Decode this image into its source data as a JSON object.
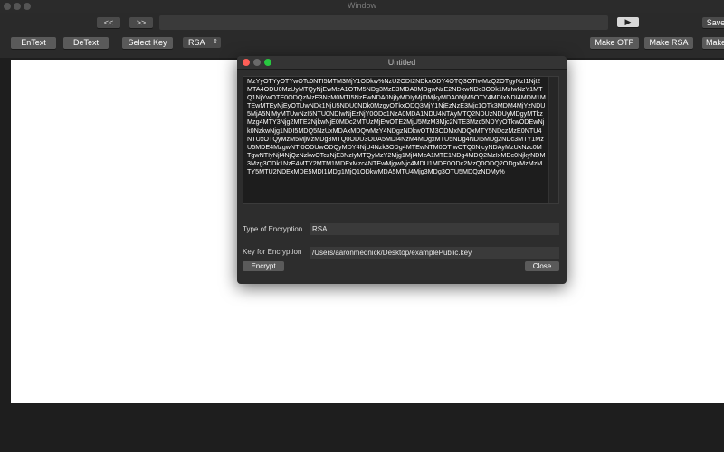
{
  "window": {
    "title": "Window"
  },
  "nav": {
    "back_label": "<<",
    "forward_label": ">>",
    "url_value": "",
    "go_label": "▶"
  },
  "toolbar": {
    "save_label": "Save",
    "entext_label": "EnText",
    "detext_label": "DeText",
    "select_key_label": "Select Key",
    "algorithm_selected": "RSA",
    "make_otp_label": "Make OTP",
    "make_rsa_label": "Make RSA",
    "make_more_label": "Make"
  },
  "dialog": {
    "title": "Untitled",
    "text_body": "MzYyOTYyOTYwOTc0NTI5MTM3MjY1ODkw%NzU2ODI2NDkxODY4OTQ3OTIwMzQ2OTgyNzI1NjI2MTA4ODU0MzUyMTQyNjEwMzA1OTM5NDg3MzE3MDA0MDgwNzE2NDkwNDc3ODk1MzIwNzY1MTQ1NjYwOTE0ODQzMzE3NzM0MTI5NzEwNDA0NjIyMDIyMjI0MjkyMDA0NjM5OTY4MDIxNDI4MDM1MTEwMTEyNjEyOTUwNDk1NjU5NDU0NDk0MzgyOTkxODQ3MjY1NjEzNzE3Mjc1OTk3MDM4MjYzNDU5MjA5NjMyMTUwNzI5NTU0NDIwNjEzNjY0ODc1NzA0MDA1NDU4NTAyMTQ2NDUzNDUyMDgyMTkzMzg4MTY3Njg2MTE2NjkwNjE0MDc2MTUzMjEwOTE2MjU5MzM3Mjc2NTE3Mzc5NDYyOTkwODEwNjk0NzkwNjg1NDI5MDQ5NzUxMDAxMDQwMzY4NDgzNDkwOTM3ODMxNDQxMTY5NDczMzE0NTU4NTUxOTQyMzM5MjMzMDg3MTQ0ODU3ODA5MDI4NzM4MDgxMTU5NDg4NDI5MDg2NDc3MTY1MzU5MDE4MzgwNTI0ODUwODQyMDY4NjU4Nzk3ODg4MTEwNTM0OTIwOTQ0NjcyNDAyMzUxNzc0MTgwNTIyNjI4NjQzNzkwOTczNjE3NzIyMTQyMzY2Mjg1MjI4MzA1MTE1NDg4MDQ2MzIxMDc0NjkyNDM3Mzg3ODk1NzE4MTY2MTM1MDExMzc4NTEwMjgwNjc4MDU1MDE0ODc2MzQ0ODQ2ODgxMzMzMTY5MTU2NDExMDE5MDI1MDg1MjQ1ODkwMDA5MTU4Mjg3MDg3OTU5MDQzNDMy%",
    "encryption_type_label": "Type of Encryption",
    "encryption_type_value": "RSA",
    "key_label": "Key for Encryption",
    "key_value": "/Users/aaronmednick/Desktop/examplePublic.key",
    "encrypt_label": "Encrypt",
    "close_label": "Close"
  },
  "colors": {
    "close_dot": "#ff5f57",
    "minimize_dot": "#febc2e",
    "zoom_dot": "#28c840",
    "content_bg": "#ffffff"
  }
}
